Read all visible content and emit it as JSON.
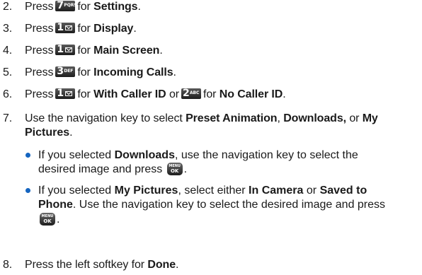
{
  "accent_color": "#1565c0",
  "word_press": "Press",
  "word_for": "for",
  "word_or": "or",
  "steps": [
    {
      "num": "2.",
      "key": {
        "digit": "7",
        "letters": "PQRS",
        "icon": "keypad-7-icon"
      },
      "target": "Settings"
    },
    {
      "num": "3.",
      "key": {
        "digit": "1",
        "letters": "",
        "icon": "keypad-1-voicemail-icon"
      },
      "target": "Display"
    },
    {
      "num": "4.",
      "key": {
        "digit": "1",
        "letters": "",
        "icon": "keypad-1-voicemail-icon"
      },
      "target": "Main Screen"
    },
    {
      "num": "5.",
      "key": {
        "digit": "3",
        "letters": "DEF",
        "icon": "keypad-3-icon"
      },
      "target": "Incoming Calls"
    },
    {
      "num": "6.",
      "key": {
        "digit": "1",
        "letters": "",
        "icon": "keypad-1-voicemail-icon"
      },
      "target": "With Caller ID",
      "key2": {
        "digit": "2",
        "letters": "ABC",
        "icon": "keypad-2-icon"
      },
      "target2": "No Caller ID"
    }
  ],
  "step7": {
    "num": "7.",
    "intro": "Use the navigation key to select",
    "opt1": "Preset Animation",
    "opt2": "Downloads,",
    "opt3_line1": "My",
    "opt3_line2": "Pictures",
    "end": "."
  },
  "bullets": [
    {
      "pre": "If you selected",
      "bold": "Downloads",
      "line1_rest": ", use the navigation key to select the",
      "line2": "desired image and press",
      "key": {
        "top": "MENU",
        "bottom": "OK",
        "icon": "menu-ok-key-icon"
      }
    },
    {
      "pre": "If you selected",
      "bold": "My Pictures",
      "mid": ", select either",
      "opt1": "In Camera",
      "or": "or",
      "opt2_line1": "Saved to",
      "opt2_line2": "Phone",
      "line2_rest": ". Use the navigation key to select the desired image and press",
      "key": {
        "top": "MENU",
        "bottom": "OK",
        "icon": "menu-ok-key-icon"
      }
    }
  ],
  "step8": {
    "num": "8.",
    "text": "Press the left softkey for",
    "bold": "Done"
  }
}
